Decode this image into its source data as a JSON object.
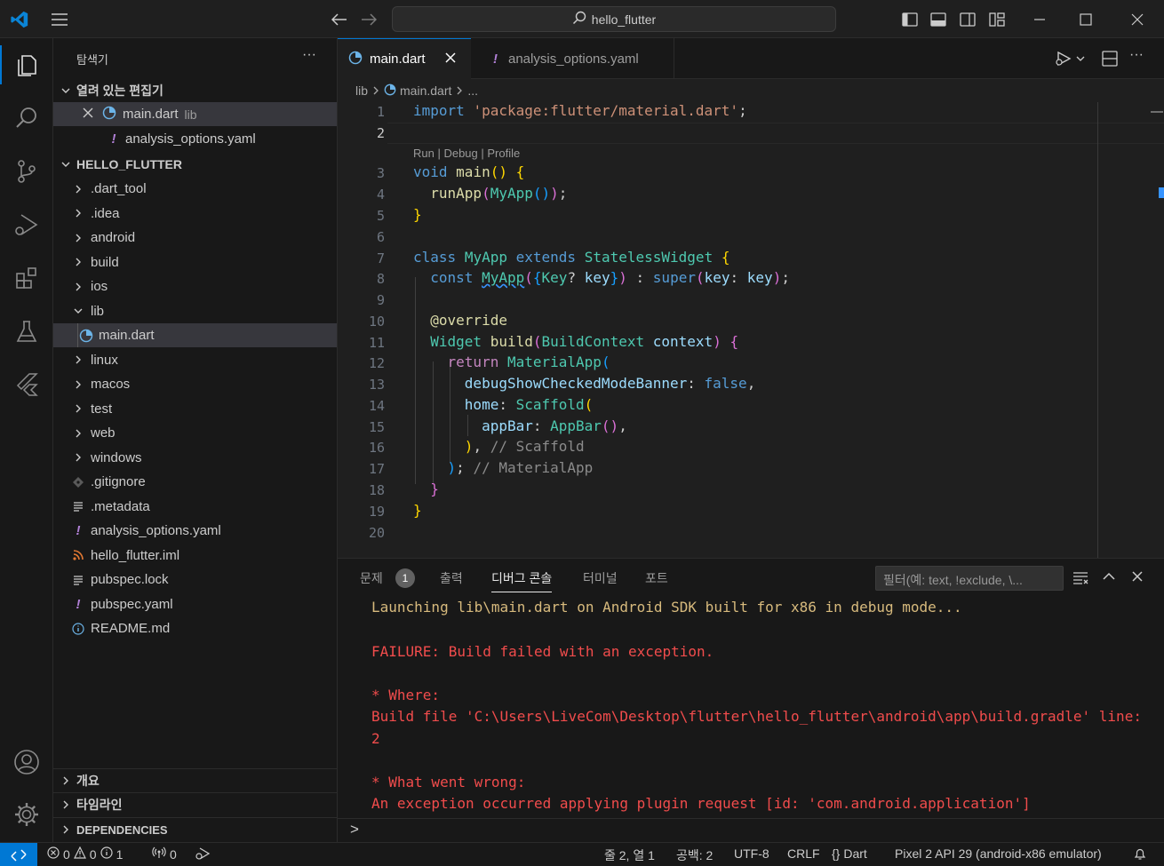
{
  "titlebar": {
    "search_text": "hello_flutter",
    "icons": [
      "vscode-logo-icon",
      "menu-icon",
      "back-arrow-icon",
      "forward-arrow-icon",
      "search-icon",
      "toggle-sidebar-icon",
      "toggle-panel-icon",
      "toggle-secondary-sidebar-icon",
      "customize-layout-icon",
      "minimize-icon",
      "maximize-icon",
      "close-icon"
    ]
  },
  "activitybar": {
    "items": [
      "explorer-icon",
      "search-icon",
      "source-control-icon",
      "run-debug-icon",
      "extensions-icon",
      "testing-icon",
      "flutter-icon",
      "account-icon",
      "settings-gear-icon"
    ]
  },
  "sidebar": {
    "title": "탐색기",
    "more": "···",
    "open_editors": {
      "label": "열려 있는 편집기",
      "items": [
        {
          "name": "main.dart",
          "desc": "lib"
        },
        {
          "name": "analysis_options.yaml",
          "desc": ""
        }
      ]
    },
    "project": {
      "label": "HELLO_FLUTTER",
      "items": [
        {
          "name": ".dart_tool",
          "type": "folder"
        },
        {
          "name": ".idea",
          "type": "folder"
        },
        {
          "name": "android",
          "type": "folder"
        },
        {
          "name": "build",
          "type": "folder"
        },
        {
          "name": "ios",
          "type": "folder"
        },
        {
          "name": "lib",
          "type": "folder-open"
        },
        {
          "name": "main.dart",
          "type": "dart"
        },
        {
          "name": "linux",
          "type": "folder"
        },
        {
          "name": "macos",
          "type": "folder"
        },
        {
          "name": "test",
          "type": "folder"
        },
        {
          "name": "web",
          "type": "folder"
        },
        {
          "name": "windows",
          "type": "folder"
        },
        {
          "name": ".gitignore",
          "type": "git"
        },
        {
          "name": ".metadata",
          "type": "lines"
        },
        {
          "name": "analysis_options.yaml",
          "type": "yaml"
        },
        {
          "name": "hello_flutter.iml",
          "type": "rss"
        },
        {
          "name": "pubspec.lock",
          "type": "lines"
        },
        {
          "name": "pubspec.yaml",
          "type": "yaml"
        },
        {
          "name": "README.md",
          "type": "info"
        }
      ]
    },
    "bottom_sections": [
      "개요",
      "타임라인",
      "DEPENDENCIES"
    ]
  },
  "tabs": [
    {
      "label": "main.dart"
    },
    {
      "label": "analysis_options.yaml"
    }
  ],
  "breadcrumb": [
    "lib",
    "main.dart",
    "..."
  ],
  "editor": {
    "codelens": "Run | Debug | Profile",
    "line_numbers": [
      "1",
      "2",
      "3",
      "4",
      "5",
      "6",
      "7",
      "8",
      "9",
      "10",
      "11",
      "12",
      "13",
      "14",
      "15",
      "16",
      "17",
      "18",
      "19",
      "20"
    ]
  },
  "panel": {
    "tabs": [
      "문제",
      "출력",
      "디버그 콘솔",
      "터미널",
      "포트"
    ],
    "problems_count": "1",
    "filter_placeholder": "필터(예: text, !exclude, \\...",
    "output": [
      "Launching lib\\main.dart on Android SDK built for x86 in debug mode...",
      "FAILURE: Build failed with an exception.",
      "* Where:",
      "Build file 'C:\\Users\\LiveCom\\Desktop\\flutter\\hello_flutter\\android\\app\\build.gradle' line:",
      "2",
      "* What went wrong:",
      "An exception occurred applying plugin request [id: 'com.android.application']"
    ],
    "prompt": ">"
  },
  "statusbar": {
    "errors": "0",
    "warnings": "0",
    "info": "1",
    "ports": "0",
    "position": "줄 2, 열 1",
    "spaces": "공백: 2",
    "encoding": "UTF-8",
    "eol": "CRLF",
    "language": "Dart",
    "device": "Pixel 2 API 29 (android-x86 emulator)"
  },
  "colors": {
    "accent": "#0078d4",
    "error": "#f14c4c",
    "warning_output": "#d7ba7d",
    "background": "#1f1f1f"
  }
}
